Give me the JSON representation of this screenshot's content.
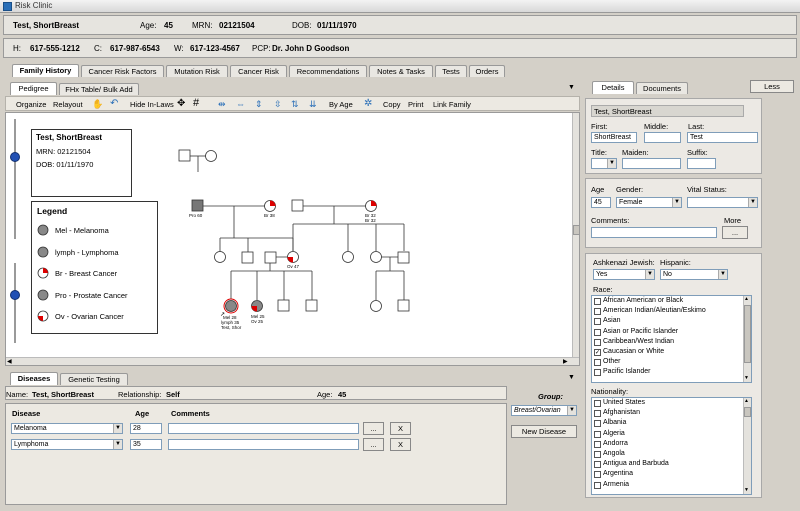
{
  "app": {
    "title": "Risk Clinic",
    "accent": "#2a6fb8"
  },
  "patient": {
    "name": "Test, ShortBreast",
    "age_label": "Age:",
    "age": "45",
    "mrn_label": "MRN:",
    "mrn": "02121504",
    "dob_label": "DOB:",
    "dob": "01/11/1970"
  },
  "contact": {
    "home_label": "H:",
    "home": "617-555-1212",
    "cell_label": "C:",
    "cell": "617-987-6543",
    "work_label": "W:",
    "work": "617-123-4567",
    "pcp_label": "PCP:",
    "pcp": "Dr. John D Goodson"
  },
  "main_tabs": [
    "Family History",
    "Cancer Risk Factors",
    "Mutation Risk",
    "Cancer Risk",
    "Recommendations",
    "Notes & Tasks",
    "Tests",
    "Orders"
  ],
  "sub_tabs": [
    "Pedigree",
    "FHx Table/ Bulk Add"
  ],
  "toolbar": {
    "organize": "Organize",
    "relayout": "Relayout",
    "hide_inlaws": "Hide In-Laws",
    "by_age": "By Age",
    "copy": "Copy",
    "print": "Print",
    "link_family": "Link Family"
  },
  "info_box": {
    "name": "Test, ShortBreast",
    "mrn": "MRN: 02121504",
    "dob": "DOB: 01/11/1970"
  },
  "legend": {
    "title": "Legend",
    "items": [
      {
        "label": "Mel - Melanoma",
        "icon": "gray-circle"
      },
      {
        "label": "lymph - Lymphoma",
        "icon": "gray-circle"
      },
      {
        "label": "Br - Breast Cancer",
        "icon": "red-quadrant-circle"
      },
      {
        "label": "Pro - Prostate Cancer",
        "icon": "gray-circle"
      },
      {
        "label": "Ov - Ovarian Cancer",
        "icon": "red-quadrant-circle"
      }
    ]
  },
  "pedigree_labels": {
    "grandfather": "Pro 60",
    "grandmother": "Br 38",
    "maternal_grandmother": "Br 32",
    "maternal_grandmother_2": "Br 32",
    "mother": "Ov 47",
    "proband_1": "Mel 28",
    "proband_2": "lymph 35",
    "proband_3": "Test, Shor",
    "sister_1": "Mel 25",
    "sister_2": "Ov 25"
  },
  "bottom_tabs": [
    "Diseases",
    "Genetic Testing"
  ],
  "disease_panel": {
    "name_label": "Name:",
    "name": "Test, ShortBreast",
    "relationship_label": "Relationship:",
    "relationship": "Self",
    "age_label": "Age:",
    "age": "45",
    "group_label": "Group:",
    "group": "Breast/Ovarian",
    "new_disease": "New Disease",
    "col_disease": "Disease",
    "col_age": "Age",
    "col_comments": "Comments",
    "rows": [
      {
        "disease": "Melanoma",
        "age": "28",
        "comments": "",
        "more": "...",
        "remove": "X"
      },
      {
        "disease": "Lymphoma",
        "age": "35",
        "comments": "",
        "more": "...",
        "remove": "X"
      }
    ]
  },
  "right_tabs": [
    "Details",
    "Documents"
  ],
  "less_button": "Less",
  "details": {
    "header": "Test, ShortBreast",
    "first_label": "First:",
    "first": "ShortBreast",
    "middle_label": "Middle:",
    "middle": "",
    "last_label": "Last:",
    "last": "Test",
    "title_label": "Title:",
    "title": "",
    "maiden_label": "Maiden:",
    "maiden": "",
    "suffix_label": "Suffix:",
    "suffix": "",
    "age_label": "Age",
    "age": "45",
    "gender_label": "Gender:",
    "gender": "Female",
    "vital_label": "Vital Status:",
    "vital": "",
    "comments_label": "Comments:",
    "comments": "",
    "more_label": "More",
    "more_button": "...",
    "ashkenazi_label": "Ashkenazi Jewish:",
    "ashkenazi": "Yes",
    "hispanic_label": "Hispanic:",
    "hispanic": "No",
    "race_label": "Race:",
    "races": [
      {
        "label": "African American or Black",
        "checked": false
      },
      {
        "label": "American Indian/Aleutian/Eskimo",
        "checked": false
      },
      {
        "label": "Asian",
        "checked": false
      },
      {
        "label": "Asian or Pacific Islander",
        "checked": false
      },
      {
        "label": "Caribbean/West Indian",
        "checked": false
      },
      {
        "label": "Caucasian or White",
        "checked": true
      },
      {
        "label": "Other",
        "checked": false
      },
      {
        "label": "Pacific Islander",
        "checked": false
      }
    ],
    "nationality_label": "Nationality:",
    "nationalities": [
      {
        "label": "United States",
        "checked": false
      },
      {
        "label": "Afghanistan",
        "checked": false
      },
      {
        "label": "Albania",
        "checked": false
      },
      {
        "label": "Algeria",
        "checked": false
      },
      {
        "label": "Andorra",
        "checked": false
      },
      {
        "label": "Angola",
        "checked": false
      },
      {
        "label": "Antigua and Barbuda",
        "checked": false
      },
      {
        "label": "Argentina",
        "checked": false
      },
      {
        "label": "Armenia",
        "checked": false
      }
    ]
  }
}
